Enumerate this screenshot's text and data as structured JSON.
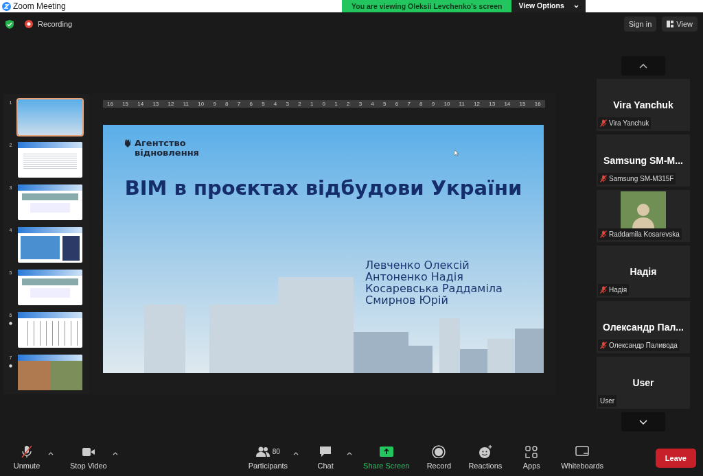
{
  "window": {
    "title": "Zoom Meeting"
  },
  "share_banner": {
    "text": "You are viewing Oleksii Levchenko's screen",
    "options_label": "View Options"
  },
  "top_bar": {
    "recording_label": "Recording",
    "sign_in": "Sign in",
    "view": "View"
  },
  "shared_screen": {
    "thumbnails": [
      {
        "number": "1",
        "kind": "title",
        "selected": true,
        "marked": false
      },
      {
        "number": "2",
        "kind": "text",
        "selected": false,
        "marked": false
      },
      {
        "number": "3",
        "kind": "form",
        "selected": false,
        "marked": false
      },
      {
        "number": "4",
        "kind": "map",
        "selected": false,
        "marked": false
      },
      {
        "number": "5",
        "kind": "form",
        "selected": false,
        "marked": false
      },
      {
        "number": "6",
        "kind": "table",
        "selected": false,
        "marked": true
      },
      {
        "number": "7",
        "kind": "photos",
        "selected": false,
        "marked": true
      }
    ],
    "ruler_labels": [
      "16",
      "15",
      "14",
      "13",
      "12",
      "11",
      "10",
      "9",
      "8",
      "7",
      "6",
      "5",
      "4",
      "3",
      "2",
      "1",
      "0",
      "1",
      "2",
      "3",
      "4",
      "5",
      "6",
      "7",
      "8",
      "9",
      "10",
      "11",
      "12",
      "13",
      "14",
      "15",
      "16"
    ],
    "slide": {
      "logo_lines": [
        "Агентство",
        "відновлення"
      ],
      "title": "ВІМ в проєктах відбудови України",
      "authors": [
        "Левченко Олексій",
        "Антоненко Надія",
        "Косаревська Раддаміла",
        "Смирнов Юрій"
      ]
    }
  },
  "participants": [
    {
      "kind": "name",
      "tile_name": "Vira Yanchuk",
      "label": "Vira Yanchuk",
      "muted": true
    },
    {
      "kind": "name",
      "tile_name": "Samsung  SM-M...",
      "label": "Samsung SM-M315F",
      "muted": true
    },
    {
      "kind": "photo",
      "label": "Raddamila Kosarevska",
      "muted": true
    },
    {
      "kind": "name",
      "tile_name": "Надія",
      "label": "Надія",
      "muted": true
    },
    {
      "kind": "name",
      "tile_name": "Олександр  Пал...",
      "label": "Олександр Паливода",
      "muted": true
    },
    {
      "kind": "name",
      "tile_name": "User",
      "label": "User",
      "muted": false
    }
  ],
  "toolbar": {
    "left": [
      {
        "kind": "unmute",
        "label": "Unmute",
        "caret": true
      },
      {
        "kind": "video",
        "label": "Stop Video",
        "caret": true
      }
    ],
    "center": [
      {
        "kind": "participants",
        "label": "Participants",
        "count": "80",
        "caret": true
      },
      {
        "kind": "chat",
        "label": "Chat",
        "caret": true
      },
      {
        "kind": "share",
        "label": "Share Screen",
        "caret": false
      },
      {
        "kind": "record",
        "label": "Record",
        "caret": false
      },
      {
        "kind": "reactions",
        "label": "Reactions",
        "caret": false
      },
      {
        "kind": "apps",
        "label": "Apps",
        "caret": false
      },
      {
        "kind": "whiteboards",
        "label": "Whiteboards",
        "caret": false
      }
    ],
    "leave": "Leave"
  }
}
